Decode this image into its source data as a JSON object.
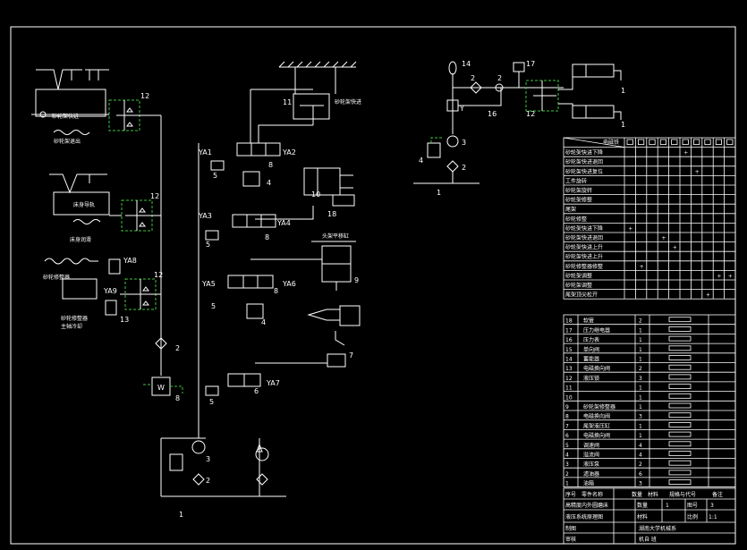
{
  "colors": {
    "background": "#000000",
    "line": "#ffffff",
    "pilot": "#3ec43e"
  },
  "left_circuit": {
    "labels": {
      "a": "砂轮架快进",
      "a2": "砂轮架退出",
      "b": "床身导轨",
      "b2": "床身润滑",
      "c": "砂轮修整器",
      "c2": "主轴",
      "d": "砂轮修整器",
      "d2": "主轴冷却"
    },
    "nums": {
      "v12a": "12",
      "v12b": "12",
      "v12c": "12",
      "ya8": "YA8",
      "ya9": "YA9",
      "n13": "13",
      "n2": "2",
      "n8": "8"
    }
  },
  "center_circuit": {
    "labels": {
      "ya1": "YA1",
      "ya2": "YA2",
      "ya3": "YA3",
      "ya4": "YA4",
      "ya5": "YA5",
      "ya6": "YA6",
      "ya7": "YA7",
      "n5a": "5",
      "n5b": "5",
      "n5c": "5",
      "n5d": "5",
      "n8a": "8",
      "n8b": "8",
      "n8c": "8",
      "n4a": "4",
      "n4b": "4",
      "n6": "6",
      "n7": "7",
      "n9": "9",
      "n10": "10",
      "n11": "11",
      "n18": "18",
      "n3": "3",
      "n2": "2",
      "n1": "1",
      "t11": "砂轮架快进",
      "t9": "头架平移缸"
    }
  },
  "right_circuit": {
    "labels": {
      "n14": "14",
      "n17": "17",
      "n2a": "2",
      "n2b": "2",
      "n2c": "2",
      "n16": "16",
      "n12": "12",
      "n3": "3",
      "n4": "4",
      "n2d": "2",
      "n1a": "1",
      "n1b": "1",
      "n1c": "1"
    }
  },
  "action_table": {
    "header": "电磁铁",
    "rows": [
      "砂轮架快进下降",
      "砂轮架快进退回",
      "砂轮架快进复位",
      "工件旋转",
      "砂轮架旋转",
      "砂轮架修整",
      "尾架",
      "砂轮修整",
      "砂轮架快进下降",
      "砂轮架快进退回",
      "砂轮架快进上升",
      "砂轮架快进上升",
      "砂轮修整器修整",
      "砂轮架调整",
      "砂轮架调整",
      "尾架顶尖松开"
    ],
    "marks": [
      [
        5
      ],
      [],
      [
        6
      ],
      [],
      [],
      [],
      [],
      [],
      [
        0
      ],
      [
        3
      ],
      [
        4
      ],
      [],
      [
        1
      ],
      [
        8,
        9
      ],
      [],
      [
        7
      ]
    ]
  },
  "parts_list": {
    "rows": [
      [
        "18",
        "软管",
        "2",
        ""
      ],
      [
        "17",
        "压力继电器",
        "1",
        ""
      ],
      [
        "16",
        "压力表",
        "1",
        ""
      ],
      [
        "15",
        "单向阀",
        "1",
        ""
      ],
      [
        "14",
        "蓄能器",
        "1",
        ""
      ],
      [
        "13",
        "电磁换向阀",
        "2",
        ""
      ],
      [
        "12",
        "液压锁",
        "3",
        ""
      ],
      [
        "11",
        "",
        "1",
        ""
      ],
      [
        "10",
        "",
        "1",
        ""
      ],
      [
        "9",
        "砂轮架修整器",
        "1",
        ""
      ],
      [
        "8",
        "电磁换向阀",
        "3",
        ""
      ],
      [
        "7",
        "尾架液压缸",
        "1",
        ""
      ],
      [
        "6",
        "电磁换向阀",
        "1",
        ""
      ],
      [
        "5",
        "调速阀",
        "4",
        ""
      ],
      [
        "4",
        "溢流阀",
        "4",
        ""
      ],
      [
        "3",
        "液压泵",
        "2",
        ""
      ],
      [
        "2",
        "滤油器",
        "6",
        ""
      ],
      [
        "1",
        "油箱",
        "3",
        ""
      ]
    ],
    "header": [
      "序号",
      "零件名称",
      "数量",
      "材料",
      "规格与代号",
      "备注"
    ]
  },
  "title_block": {
    "title1": "高精度内外圆磨床",
    "title2": "液压系统原理图",
    "qty_label": "数量",
    "qty": "1",
    "sheet_label": "图号",
    "sheet": "3",
    "mat_label": "材料",
    "scale_label": "比例",
    "scale": "1:1",
    "drawn": "制图",
    "checked": "审核",
    "school": "湖南大学机械系",
    "class": "机自 班"
  }
}
